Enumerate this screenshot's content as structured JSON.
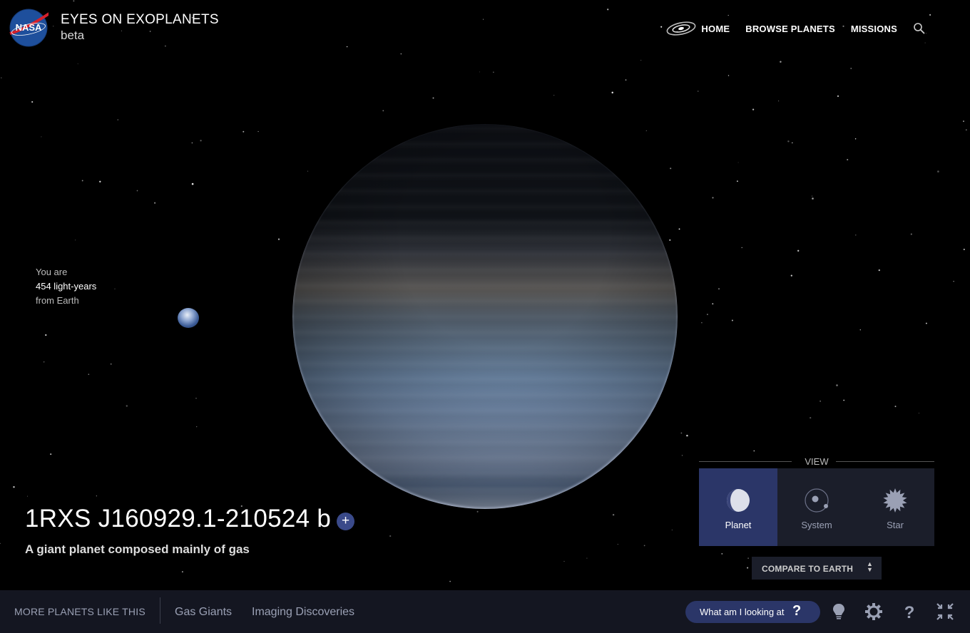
{
  "header": {
    "logo_text": "NASA",
    "title": "EYES ON EXOPLANETS",
    "subtitle": "beta"
  },
  "nav": {
    "items": [
      {
        "label": "HOME"
      },
      {
        "label": "BROWSE PLANETS"
      },
      {
        "label": "MISSIONS"
      }
    ],
    "icons": [
      "galaxy-icon",
      "search-icon"
    ]
  },
  "distance": {
    "prefix": "You are",
    "value": "454 light-years",
    "suffix": "from Earth"
  },
  "planet": {
    "name": "1RXS J160929.1-210524 b",
    "description": "A giant planet composed mainly of gas",
    "add_label": "+"
  },
  "view": {
    "heading": "VIEW",
    "options": [
      {
        "label": "Planet",
        "icon": "planet-icon",
        "active": true
      },
      {
        "label": "System",
        "icon": "system-icon",
        "active": false
      },
      {
        "label": "Star",
        "icon": "star-icon",
        "active": false
      }
    ]
  },
  "compare": {
    "label": "COMPARE TO EARTH"
  },
  "footer": {
    "more_label": "MORE PLANETS LIKE THIS",
    "categories": [
      {
        "label": "Gas Giants"
      },
      {
        "label": "Imaging Discoveries"
      }
    ],
    "what_label": "What am I looking at",
    "what_icon": "?",
    "icons": [
      "lightbulb-icon",
      "gear-icon",
      "help-icon",
      "fullscreen-icon"
    ]
  },
  "colors": {
    "accent": "#2b3668",
    "panel": "#1b1e2a",
    "footer_bg": "#141621",
    "muted_text": "#9aa0b4"
  }
}
